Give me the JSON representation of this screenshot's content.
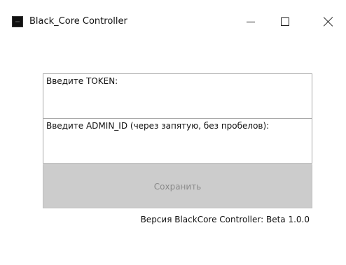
{
  "window": {
    "title": "Black_Core Controller",
    "controls": {
      "minimize": "minimize-icon",
      "maximize": "maximize-icon",
      "close": "close-icon"
    }
  },
  "form": {
    "token": {
      "label": "Введите TOKEN:",
      "value": ""
    },
    "admin_id": {
      "label": "Введите ADMIN_ID (через запятую, без пробелов):",
      "value": ""
    },
    "save_label": "Сохранить"
  },
  "footer": {
    "version_text": "Версия BlackCore Controller: Beta 1.0.0"
  }
}
